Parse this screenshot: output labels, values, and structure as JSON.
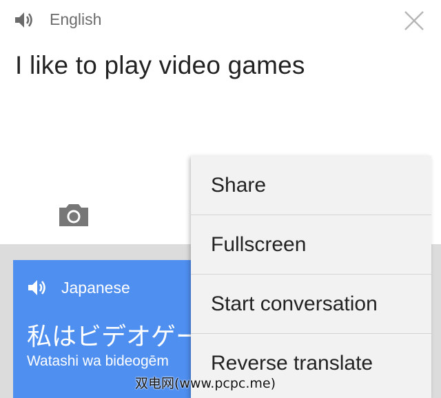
{
  "source": {
    "language": "English",
    "text": "I like to play video games",
    "speaker_icon": "speaker-icon",
    "close_icon": "close-icon",
    "camera_icon": "camera-icon"
  },
  "result": {
    "language": "Japanese",
    "text": "私はビデオゲー",
    "romanization": "Watashi wa bideogēm",
    "speaker_icon": "speaker-icon"
  },
  "menu": {
    "items": [
      {
        "label": "Share"
      },
      {
        "label": "Fullscreen"
      },
      {
        "label": "Start conversation"
      },
      {
        "label": "Reverse translate"
      }
    ]
  },
  "watermark": "双电网(www.pcpc.me)",
  "colors": {
    "accent": "#4f8ff0",
    "background": "#ffffff",
    "menu_background": "#f2f2f2",
    "lower_background": "#dcdcdc"
  }
}
